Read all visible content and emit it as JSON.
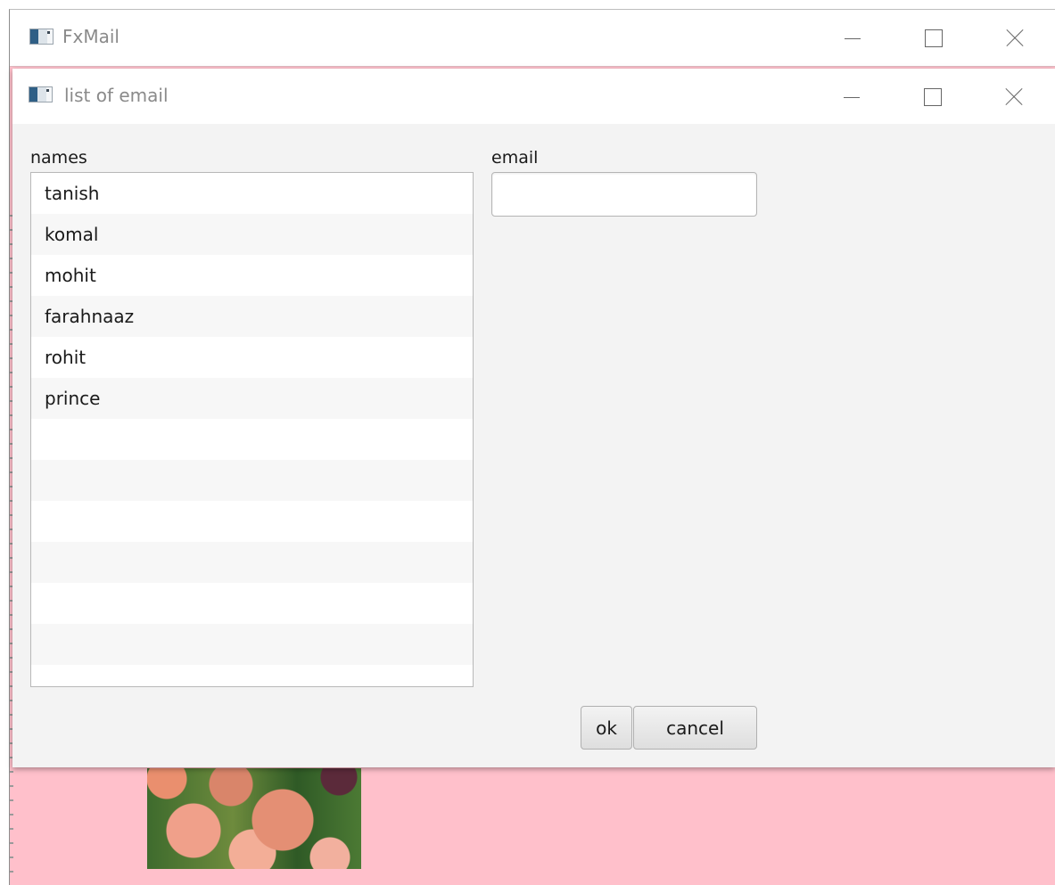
{
  "main_window": {
    "title": "FxMail",
    "icon": "java-app-icon"
  },
  "dialog": {
    "title": "list of email",
    "icon": "java-app-icon",
    "names_label": "names",
    "email_label": "email",
    "email_value": "",
    "names": [
      "tanish",
      "komal",
      "mohit",
      "farahnaaz",
      "rohit",
      "prince",
      "",
      "",
      "",
      "",
      "",
      ""
    ],
    "ok_label": "ok",
    "cancel_label": "cancel"
  },
  "colors": {
    "main_background": "#ffc0cb",
    "dialog_background": "#f3f3f3"
  }
}
